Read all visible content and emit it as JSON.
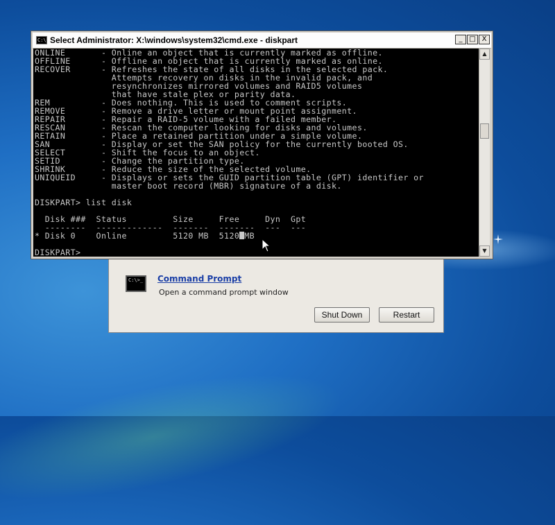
{
  "desktop": {
    "background_color": "#1f6fc4"
  },
  "recovery_dialog": {
    "option_icon_text": "C:\\>_",
    "option_title": "Command Prompt",
    "option_description": "Open a command prompt window",
    "shutdown_label": "Shut Down",
    "restart_label": "Restart"
  },
  "cmd_window": {
    "icon_text": "C:\\",
    "title": "Select Administrator: X:\\windows\\system32\\cmd.exe - diskpart",
    "minimize_glyph": "_",
    "maximize_glyph": "□",
    "close_glyph": "X",
    "scroll_up_glyph": "▲",
    "scroll_down_glyph": "▼",
    "lines": [
      "ONLINE       - Online an object that is currently marked as offline.",
      "OFFLINE      - Offline an object that is currently marked as online.",
      "RECOVER      - Refreshes the state of all disks in the selected pack.",
      "               Attempts recovery on disks in the invalid pack, and",
      "               resynchronizes mirrored volumes and RAID5 volumes",
      "               that have stale plex or parity data.",
      "REM          - Does nothing. This is used to comment scripts.",
      "REMOVE       - Remove a drive letter or mount point assignment.",
      "REPAIR       - Repair a RAID-5 volume with a failed member.",
      "RESCAN       - Rescan the computer looking for disks and volumes.",
      "RETAIN       - Place a retained partition under a simple volume.",
      "SAN          - Display or set the SAN policy for the currently booted OS.",
      "SELECT       - Shift the focus to an object.",
      "SETID        - Change the partition type.",
      "SHRINK       - Reduce the size of the selected volume.",
      "UNIQUEID     - Displays or sets the GUID partition table (GPT) identifier or",
      "               master boot record (MBR) signature of a disk.",
      "",
      "DISKPART> list disk",
      "",
      "  Disk ###  Status         Size     Free     Dyn  Gpt",
      "  --------  -------------  -------  -------  ---  ---"
    ],
    "disk_row_before_cursor": "* Disk 0    Online         5120 MB  5120",
    "disk_row_after_cursor": "MB",
    "blank_line": "",
    "prompt": "DISKPART> "
  }
}
